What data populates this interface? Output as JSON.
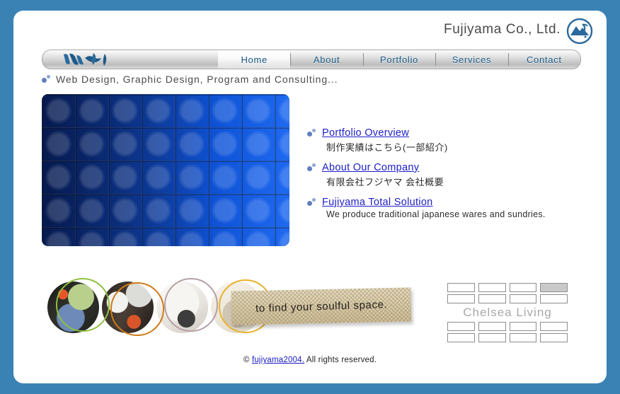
{
  "header": {
    "brand_title": "Fujiyama Co., Ltd.",
    "brand_mark_icon": "mountain-circle-logo-icon"
  },
  "nav": {
    "logo_icon": "fujiyama-brush-logo-icon",
    "items": [
      {
        "label": "Home",
        "active": true
      },
      {
        "label": "About",
        "active": false
      },
      {
        "label": "Portfolio",
        "active": false
      },
      {
        "label": "Services",
        "active": false
      },
      {
        "label": "Contact",
        "active": false
      }
    ]
  },
  "tagline": {
    "bullet_icon": "two-dots-bullet-icon",
    "text": "Web Design, Graphic Design, Program and Consulting..."
  },
  "hero": {
    "alt": "blue rounded-square tile pattern graphic"
  },
  "links": [
    {
      "bullet_icon": "two-dots-bullet-icon",
      "label": "Portfolio Overview",
      "description": "制作実績はこちら(一部紹介)",
      "is_japanese": true
    },
    {
      "bullet_icon": "two-dots-bullet-icon",
      "label": "About Our Company",
      "description": "有限会社フジヤマ  会社概要",
      "is_japanese": true
    },
    {
      "bullet_icon": "two-dots-bullet-icon",
      "label": "Fujiyama Total Solution",
      "description": "We produce traditional japanese wares and sundries.",
      "is_japanese": false
    }
  ],
  "photo_banner": {
    "cloth_text": "to find your soulful  space.",
    "circles": [
      {
        "name": "photo-circle-vegetables",
        "ring_color": "#8fc03f"
      },
      {
        "name": "photo-circle-interior",
        "ring_color": "#d07a18"
      },
      {
        "name": "photo-circle-chair",
        "ring_color": "#b69fa4"
      },
      {
        "name": "photo-circle-cloth",
        "ring_color": "#e8b12a"
      }
    ]
  },
  "chelsea": {
    "title": "Chelsea Living",
    "rows": [
      {
        "boxes": [
          false,
          false,
          false,
          true
        ]
      },
      {
        "boxes": [
          false,
          false,
          false,
          false
        ]
      },
      {
        "boxes": [
          false,
          false,
          false,
          false
        ]
      },
      {
        "boxes": [
          false,
          false,
          false,
          false
        ]
      }
    ]
  },
  "footer": {
    "copyright_symbol": "©",
    "link_label": "fujiyama2004.",
    "rights_text": "All rights reserved."
  },
  "colors": {
    "frame": "#3a82b4",
    "page": "#ffffff",
    "nav_text": "#1d5f8a",
    "link": "#2020c8",
    "hero_blue_dark": "#0b2f8d",
    "hero_blue_bright": "#1160ef",
    "chelsea_gray": "#a8a8a8"
  }
}
